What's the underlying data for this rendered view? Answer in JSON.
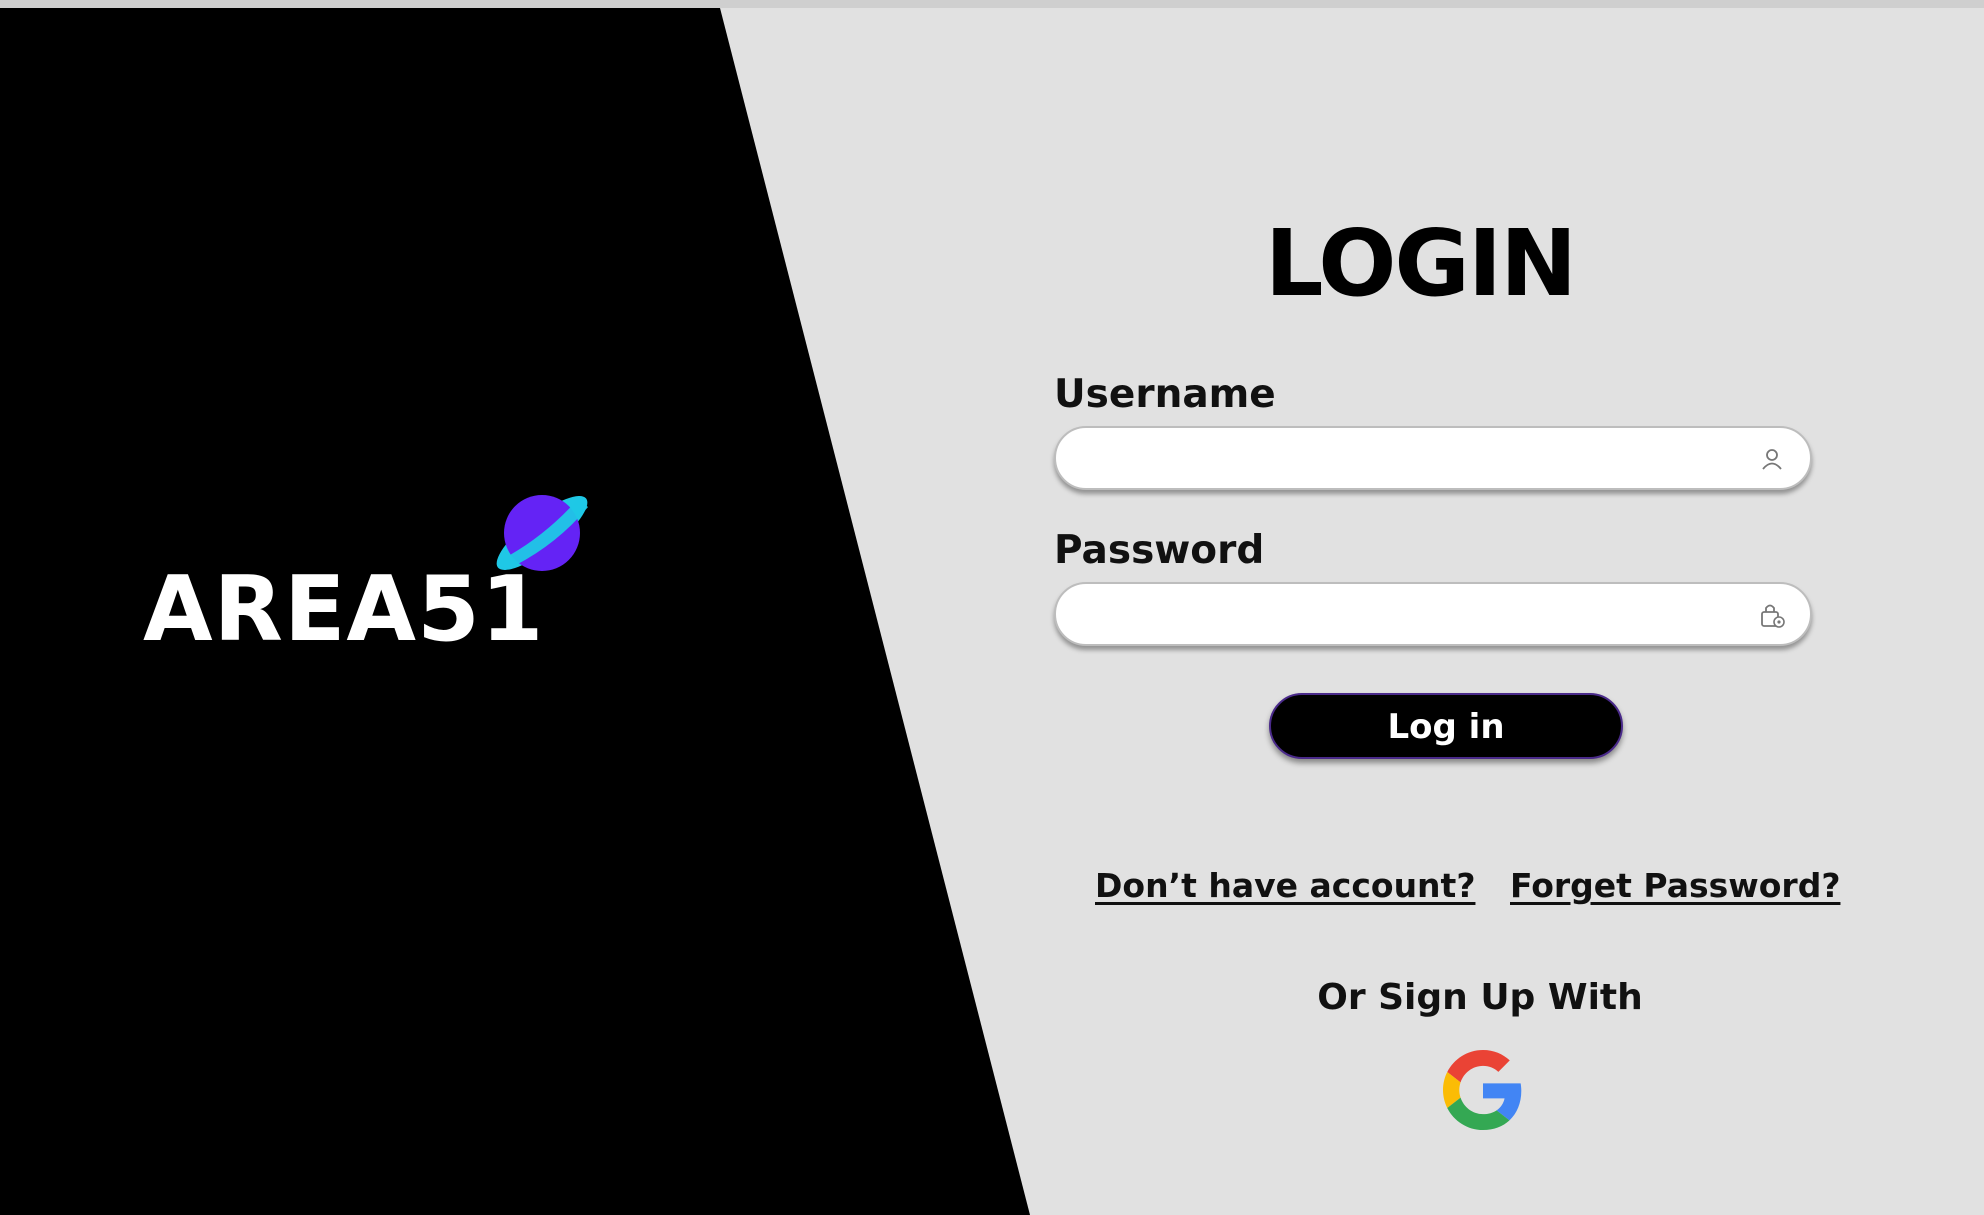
{
  "brand": {
    "name": "AREA51",
    "logo_icon": "planet-icon",
    "colors": {
      "panel": "#000000",
      "planet": "#6423f5",
      "ring": "#1fc8e6"
    }
  },
  "login": {
    "title": "LOGIN",
    "username": {
      "label": "Username",
      "value": "",
      "placeholder": "",
      "icon": "user-icon"
    },
    "password": {
      "label": "Password",
      "value": "",
      "placeholder": "",
      "icon": "lock-icon"
    },
    "submit_label": "Log in",
    "links": {
      "signup": "Don’t have account?",
      "forgot": "Forget Password?"
    },
    "alt_signup": {
      "label": "Or Sign Up With",
      "provider_icon": "google-icon"
    }
  },
  "colors": {
    "background": "#e1e1e1",
    "button": "#000000",
    "button_border": "#4a2a8a"
  }
}
